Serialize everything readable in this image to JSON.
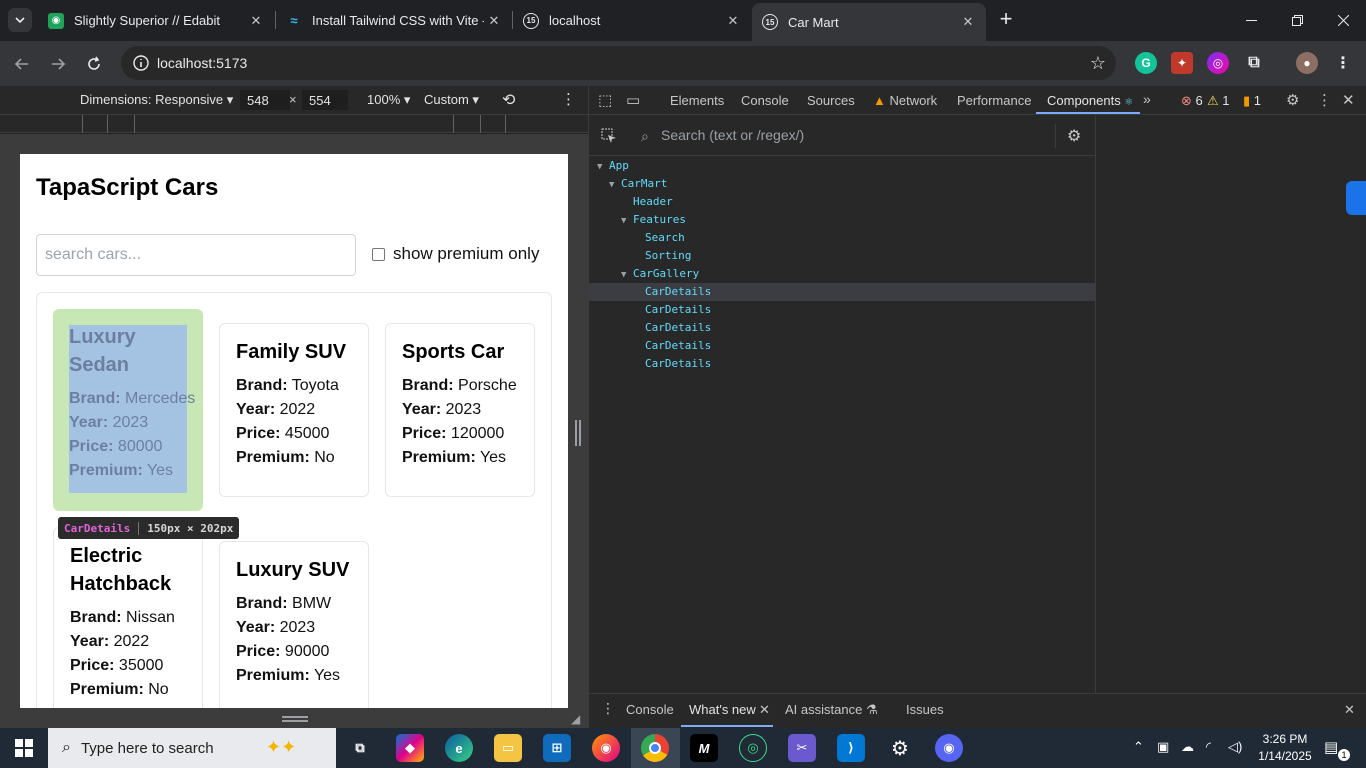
{
  "browser": {
    "tabs": [
      {
        "title": "Slightly Superior // Edabit",
        "favicon": "edabit-icon"
      },
      {
        "title": "Install Tailwind CSS with Vite - T",
        "favicon": "tailwind-icon"
      },
      {
        "title": "localhost",
        "favicon": "vite-icon"
      },
      {
        "title": "Car Mart",
        "favicon": "vite-icon"
      }
    ],
    "url": "localhost:5173"
  },
  "device_toolbar": {
    "dimensions_label": "Dimensions: Responsive",
    "width": "548",
    "times": "×",
    "height": "554",
    "zoom": "100%",
    "throttle": "Custom"
  },
  "page": {
    "title": "TapaScript Cars",
    "search_placeholder": "search cars...",
    "premium_label": "show premium only",
    "field_labels": {
      "brand": "Brand:",
      "year": "Year:",
      "price": "Price:",
      "premium": "Premium:"
    },
    "cars": [
      {
        "name": "Luxury Sedan",
        "brand": "Mercedes",
        "year": "2023",
        "price": "80000",
        "premium": "Yes"
      },
      {
        "name": "Family SUV",
        "brand": "Toyota",
        "year": "2022",
        "price": "45000",
        "premium": "No"
      },
      {
        "name": "Sports Car",
        "brand": "Porsche",
        "year": "2023",
        "price": "120000",
        "premium": "Yes"
      },
      {
        "name": "Electric Hatchback",
        "brand": "Nissan",
        "year": "2022",
        "price": "35000",
        "premium": "No"
      },
      {
        "name": "Luxury SUV",
        "brand": "BMW",
        "year": "2023",
        "price": "90000",
        "premium": "Yes"
      }
    ],
    "highlight_tooltip": {
      "name": "CarDetails",
      "size": "150px × 202px"
    }
  },
  "devtools": {
    "tabs": [
      "Elements",
      "Console",
      "Sources",
      "Network",
      "Performance",
      "Components"
    ],
    "active_tab": "Components",
    "errors": "6",
    "warnings": "1",
    "issues": "1",
    "component_search_placeholder": "Search (text or /regex/)",
    "tree": [
      {
        "name": "App",
        "expanded": true
      },
      {
        "name": "CarMart",
        "expanded": true
      },
      {
        "name": "Header"
      },
      {
        "name": "Features",
        "expanded": true
      },
      {
        "name": "Search"
      },
      {
        "name": "Sorting"
      },
      {
        "name": "CarGallery",
        "expanded": true
      },
      {
        "name": "CarDetails",
        "selected": true
      },
      {
        "name": "CarDetails"
      },
      {
        "name": "CarDetails"
      },
      {
        "name": "CarDetails"
      },
      {
        "name": "CarDetails"
      }
    ],
    "drawer_tabs": [
      "Console",
      "What's new",
      "AI assistance",
      "Issues"
    ],
    "drawer_active": "What's new"
  },
  "taskbar": {
    "search_placeholder": "Type here to search",
    "time": "3:26 PM",
    "date": "1/14/2025",
    "notification_count": "1"
  },
  "colors": {
    "react_component": "#61dafb",
    "highlight_margin": "#c7e7b4",
    "highlight_content": "#a4c3e3",
    "accent": "#7cacf8"
  }
}
